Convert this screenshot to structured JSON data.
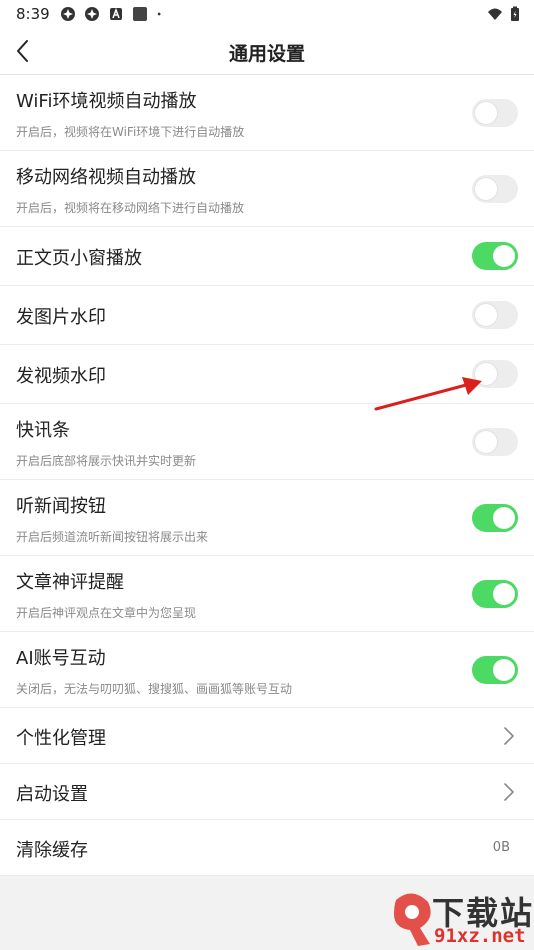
{
  "status_bar": {
    "time": "8:39",
    "left_icons": [
      "app-icon",
      "app-icon",
      "app-icon",
      "app-icon",
      "dot-icon"
    ],
    "right_icons": [
      "wifi-icon",
      "battery-icon"
    ]
  },
  "header": {
    "title": "通用设置",
    "back_icon": "chevron-left-icon"
  },
  "settings": [
    {
      "title": "WiFi环境视频自动播放",
      "subtitle": "开启后，视频将在WiFi环境下进行自动播放",
      "on": false
    },
    {
      "title": "移动网络视频自动播放",
      "subtitle": "开启后，视频将在移动网络下进行自动播放",
      "on": false
    },
    {
      "title": "正文页小窗播放",
      "on": true
    },
    {
      "title": "发图片水印",
      "on": false
    },
    {
      "title": "发视频水印",
      "on": false
    },
    {
      "title": "快讯条",
      "subtitle": "开启后底部将展示快讯并实时更新",
      "on": false
    },
    {
      "title": "听新闻按钮",
      "subtitle": "开启后频道流听新闻按钮将展示出来",
      "on": true
    },
    {
      "title": "文章神评提醒",
      "subtitle": "开启后神评观点在文章中为您呈现",
      "on": true
    },
    {
      "title": "AI账号互动",
      "subtitle": "关闭后，无法与叨叨狐、搜搜狐、画画狐等账号互动",
      "on": true
    }
  ],
  "nav_items": [
    {
      "title": "个性化管理"
    },
    {
      "title": "启动设置"
    },
    {
      "title": "清除缓存",
      "value": "0B"
    }
  ],
  "colors": {
    "toggle_on": "#4cd964",
    "toggle_off": "#ededed",
    "annotation_arrow": "#d9201c"
  },
  "watermark": {
    "text": "下载站",
    "url": "91xz.net"
  }
}
